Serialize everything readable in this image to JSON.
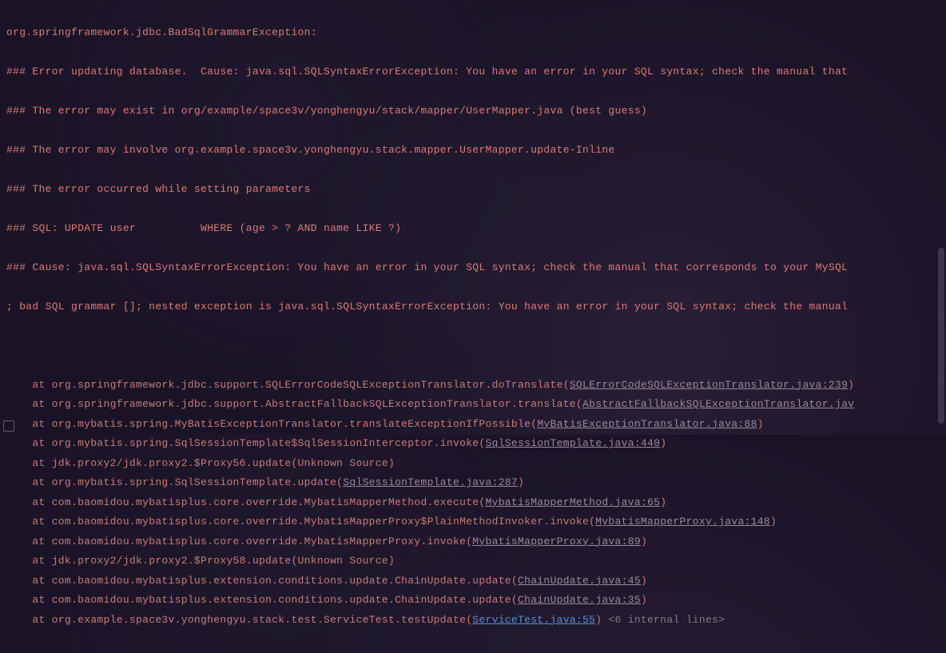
{
  "exception": {
    "header": "org.springframework.jdbc.BadSqlGrammarException:",
    "lines": [
      "### Error updating database.  Cause: java.sql.SQLSyntaxErrorException: You have an error in your SQL syntax; check the manual that ",
      "### The error may exist in org/example/space3v/yonghengyu/stack/mapper/UserMapper.java (best guess)",
      "### The error may involve org.example.space3v.yonghengyu.stack.mapper.UserMapper.update-Inline",
      "### The error occurred while setting parameters",
      "### SQL: UPDATE user          WHERE (age > ? AND name LIKE ?)",
      "### Cause: java.sql.SQLSyntaxErrorException: You have an error in your SQL syntax; check the manual that corresponds to your MySQL ",
      "; bad SQL grammar []; nested exception is java.sql.SQLSyntaxErrorException: You have an error in your SQL syntax; check the manual "
    ]
  },
  "stack": [
    {
      "pre": "    at org.springframework.jdbc.support.SQLErrorCodeSQLExceptionTranslator.doTranslate(",
      "link": "SQLErrorCodeSQLExceptionTranslator.java:239",
      "post": ")"
    },
    {
      "pre": "    at org.springframework.jdbc.support.AbstractFallbackSQLExceptionTranslator.translate(",
      "link": "AbstractFallbackSQLExceptionTranslator.jav",
      "post": ""
    },
    {
      "pre": "    at org.mybatis.spring.MyBatisExceptionTranslator.translateExceptionIfPossible(",
      "link": "MyBatisExceptionTranslator.java:88",
      "post": ")"
    },
    {
      "pre": "    at org.mybatis.spring.SqlSessionTemplate$SqlSessionInterceptor.invoke(",
      "link": "SqlSessionTemplate.java:440",
      "post": ")"
    },
    {
      "pre": "    at jdk.proxy2/jdk.proxy2.$Proxy56.update(Unknown Source)",
      "link": "",
      "post": ""
    },
    {
      "pre": "    at org.mybatis.spring.SqlSessionTemplate.update(",
      "link": "SqlSessionTemplate.java:287",
      "post": ")"
    },
    {
      "pre": "    at com.baomidou.mybatisplus.core.override.MybatisMapperMethod.execute(",
      "link": "MybatisMapperMethod.java:65",
      "post": ")"
    },
    {
      "pre": "    at com.baomidou.mybatisplus.core.override.MybatisMapperProxy$PlainMethodInvoker.invoke(",
      "link": "MybatisMapperProxy.java:148",
      "post": ")"
    },
    {
      "pre": "    at com.baomidou.mybatisplus.core.override.MybatisMapperProxy.invoke(",
      "link": "MybatisMapperProxy.java:89",
      "post": ")"
    },
    {
      "pre": "    at jdk.proxy2/jdk.proxy2.$Proxy58.update(Unknown Source)",
      "link": "",
      "post": ""
    },
    {
      "pre": "    at com.baomidou.mybatisplus.extension.conditions.update.ChainUpdate.update(",
      "link": "ChainUpdate.java:45",
      "post": ")"
    },
    {
      "pre": "    at com.baomidou.mybatisplus.extension.conditions.update.ChainUpdate.update(",
      "link": "ChainUpdate.java:35",
      "post": ")"
    },
    {
      "pre": "    at org.example.space3v.yonghengyu.stack.test.ServiceTest.testUpdate(",
      "link": "ServiceTest.java:55",
      "linkClass": "link-blue",
      "post": ") ",
      "tail": "<6 internal lines>"
    }
  ]
}
